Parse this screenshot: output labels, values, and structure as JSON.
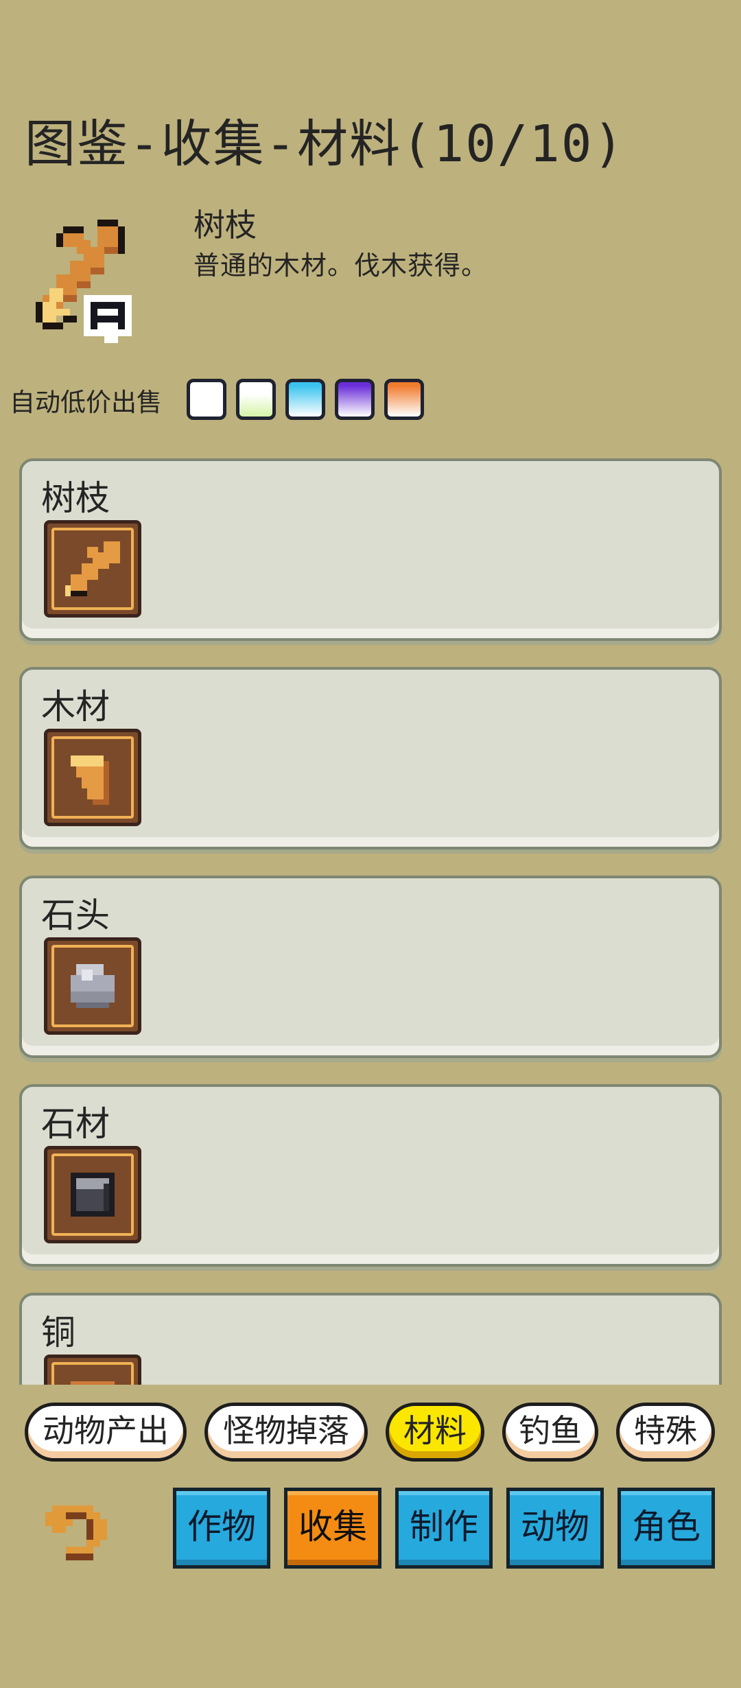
{
  "title": "图鉴-收集-材料(10/10)",
  "selected": {
    "name": "树枝",
    "description": "普通的木材。伐木获得。",
    "icon": "branch-icon"
  },
  "autosell": {
    "label": "自动低价出售",
    "swatches": [
      "#ffffff",
      "#d6f3a8",
      "#3bc3ee",
      "#6a2ed9",
      "#f07c2e"
    ]
  },
  "items": [
    {
      "label": "树枝",
      "icon": "branch-icon"
    },
    {
      "label": "木材",
      "icon": "wood-plank-icon"
    },
    {
      "label": "石头",
      "icon": "stone-icon"
    },
    {
      "label": "石材",
      "icon": "stone-block-icon"
    },
    {
      "label": "铜",
      "icon": "copper-icon"
    }
  ],
  "subcategories": [
    {
      "label": "动物产出",
      "active": false
    },
    {
      "label": "怪物掉落",
      "active": false
    },
    {
      "label": "材料",
      "active": true
    },
    {
      "label": "钓鱼",
      "active": false
    },
    {
      "label": "特殊",
      "active": false
    }
  ],
  "tabs": [
    {
      "label": "作物",
      "active": false
    },
    {
      "label": "收集",
      "active": true
    },
    {
      "label": "制作",
      "active": false
    },
    {
      "label": "动物",
      "active": false
    },
    {
      "label": "角色",
      "active": false
    }
  ],
  "back_icon": "undo-arrow-icon"
}
